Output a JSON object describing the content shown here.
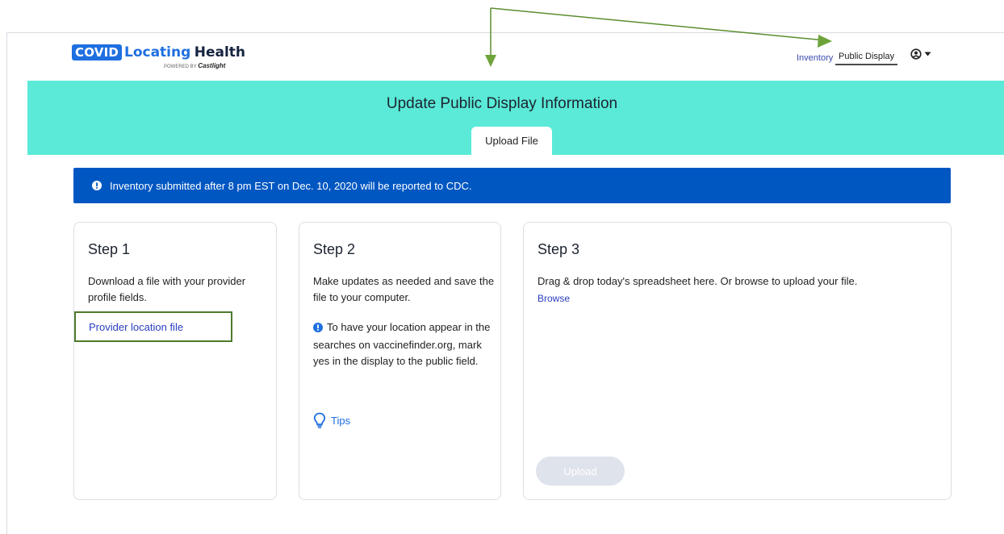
{
  "header": {
    "logo_badge": "COVID",
    "logo_locating": "Locating",
    "logo_health": "Health",
    "logo_powered": "POWERED BY",
    "logo_brand": "Castlight",
    "nav_inventory": "Inventory",
    "nav_public_display": "Public Display",
    "user_icon": "user-circle-icon"
  },
  "banner": {
    "title": "Update Public Display Information",
    "tab_upload": "Upload File"
  },
  "alert": {
    "icon": "exclamation-circle-icon",
    "text": "Inventory submitted after 8 pm EST on Dec. 10, 2020 will be reported to CDC."
  },
  "steps": {
    "step1": {
      "title": "Step 1",
      "desc": "Download a file with your provider profile fields.",
      "link": "Provider location file"
    },
    "step2": {
      "title": "Step 2",
      "desc": "Make updates as needed and save the file to your computer.",
      "note": "To have your location appear in the searches on vaccinefinder.org, mark yes in the display to the public field.",
      "tips": "Tips",
      "tips_icon": "lightbulb-icon"
    },
    "step3": {
      "title": "Step 3",
      "desc": "Drag & drop today's spreadsheet here. Or browse to upload your file.",
      "browse": "Browse",
      "upload": "Upload"
    }
  },
  "colors": {
    "banner": "#5aead7",
    "alert": "#0057c2",
    "link": "#2a3fbf",
    "annotation": "#5b8e2e"
  }
}
